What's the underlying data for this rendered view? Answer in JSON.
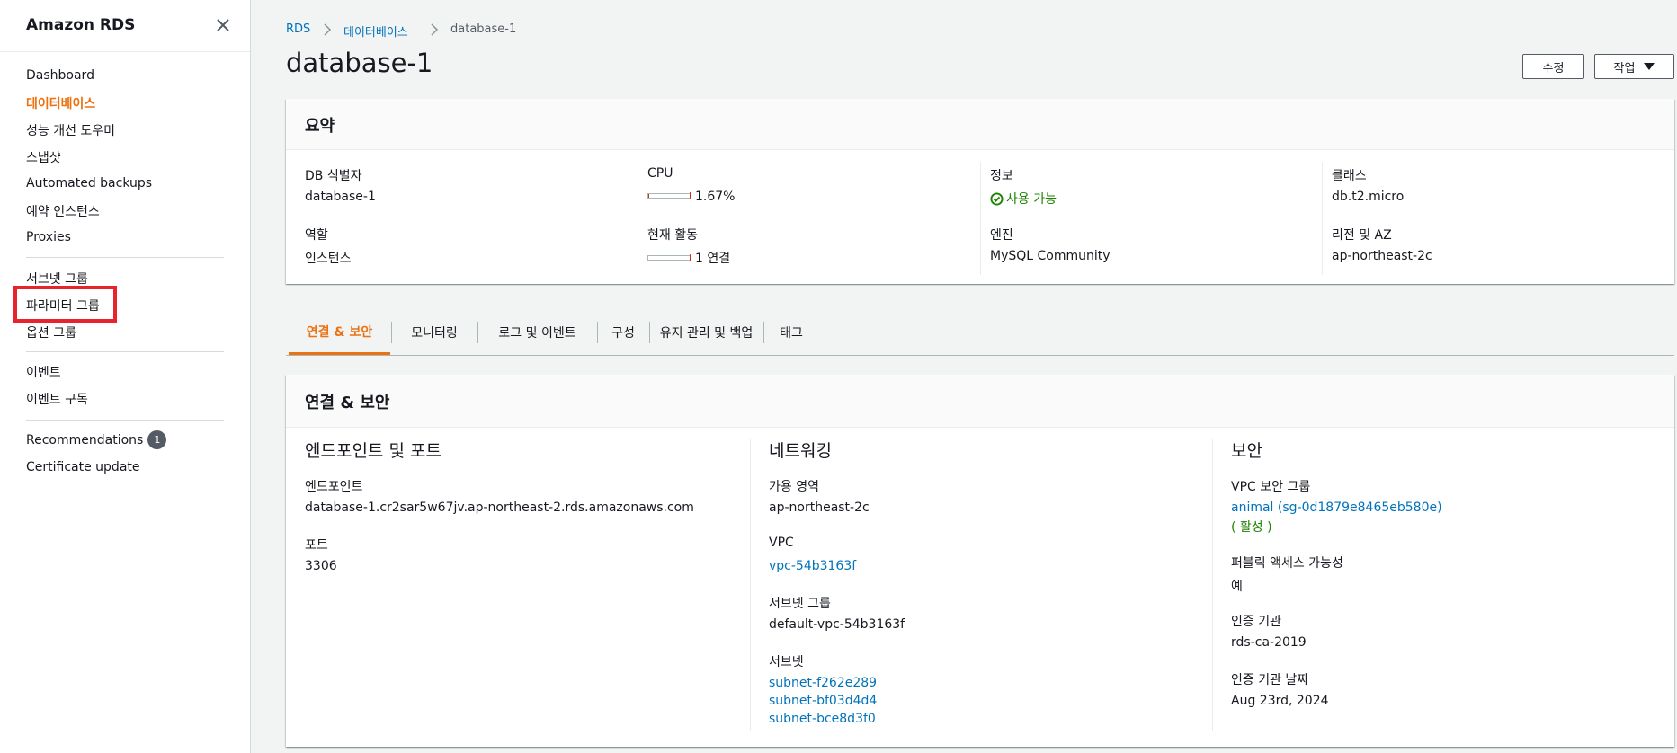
{
  "sidebar": {
    "title": "Amazon RDS",
    "items": [
      {
        "label": "Dashboard"
      },
      {
        "label": "데이터베이스"
      },
      {
        "label": "성능 개선 도우미"
      },
      {
        "label": "스냅샷"
      },
      {
        "label": "Automated backups"
      },
      {
        "label": "예약 인스턴스"
      },
      {
        "label": "Proxies"
      },
      {
        "label": "서브넷 그룹"
      },
      {
        "label": "파라미터 그룹"
      },
      {
        "label": "옵션 그룹"
      },
      {
        "label": "이벤트"
      },
      {
        "label": "이벤트 구독"
      },
      {
        "label": "Recommendations",
        "badge": "1"
      },
      {
        "label": "Certificate update"
      }
    ],
    "active_item": "데이터베이스",
    "highlighted_item": "파라미터 그룹"
  },
  "breadcrumb": [
    "RDS",
    "데이터베이스",
    "database-1"
  ],
  "page_title": "database-1",
  "actions": {
    "modify": "수정",
    "actions": "작업"
  },
  "summary": {
    "title": "요약",
    "db_id_label": "DB 식별자",
    "db_id": "database-1",
    "role_label": "역할",
    "role": "인스턴스",
    "cpu_label": "CPU",
    "cpu": "1.67%",
    "cpu_fraction": 0.0167,
    "activity_label": "현재 활동",
    "activity": "1 연결",
    "status_label": "정보",
    "status": "사용 가능",
    "engine_label": "엔진",
    "engine": "MySQL Community",
    "class_label": "클래스",
    "class": "db.t2.micro",
    "region_label": "리전 및 AZ",
    "region": "ap-northeast-2c"
  },
  "tabs": [
    "연결 & 보안",
    "모니터링",
    "로그 및 이벤트",
    "구성",
    "유지 관리 및 백업",
    "태그"
  ],
  "active_tab": "연결 & 보안",
  "connectivity": {
    "title": "연결 & 보안",
    "endpoint_section": {
      "heading": "엔드포인트 및 포트",
      "endpoint_label": "엔드포인트",
      "endpoint": "database-1.cr2sar5w67jv.ap-northeast-2.rds.amazonaws.com",
      "port_label": "포트",
      "port": "3306"
    },
    "networking_section": {
      "heading": "네트워킹",
      "az_label": "가용 영역",
      "az": "ap-northeast-2c",
      "vpc_label": "VPC",
      "vpc": "vpc-54b3163f",
      "subnet_group_label": "서브넷 그룹",
      "subnet_group": "default-vpc-54b3163f",
      "subnets_label": "서브넷",
      "subnets": [
        "subnet-f262e289",
        "subnet-bf03d4d4",
        "subnet-bce8d3f0"
      ]
    },
    "security_section": {
      "heading": "보안",
      "sg_label": "VPC 보안 그룹",
      "sg": "animal (sg-0d1879e8465eb580e)",
      "sg_status": "( 활성 )",
      "public_label": "퍼블릭 액세스 가능성",
      "public": "예",
      "ca_label": "인증 기관",
      "ca": "rds-ca-2019",
      "ca_date_label": "인증 기관 날짜",
      "ca_date": "Aug 23rd, 2024"
    }
  },
  "colors": {
    "accent": "#ec7211",
    "link": "#0073bb",
    "success": "#1d8102",
    "highlight": "#e8232e"
  }
}
